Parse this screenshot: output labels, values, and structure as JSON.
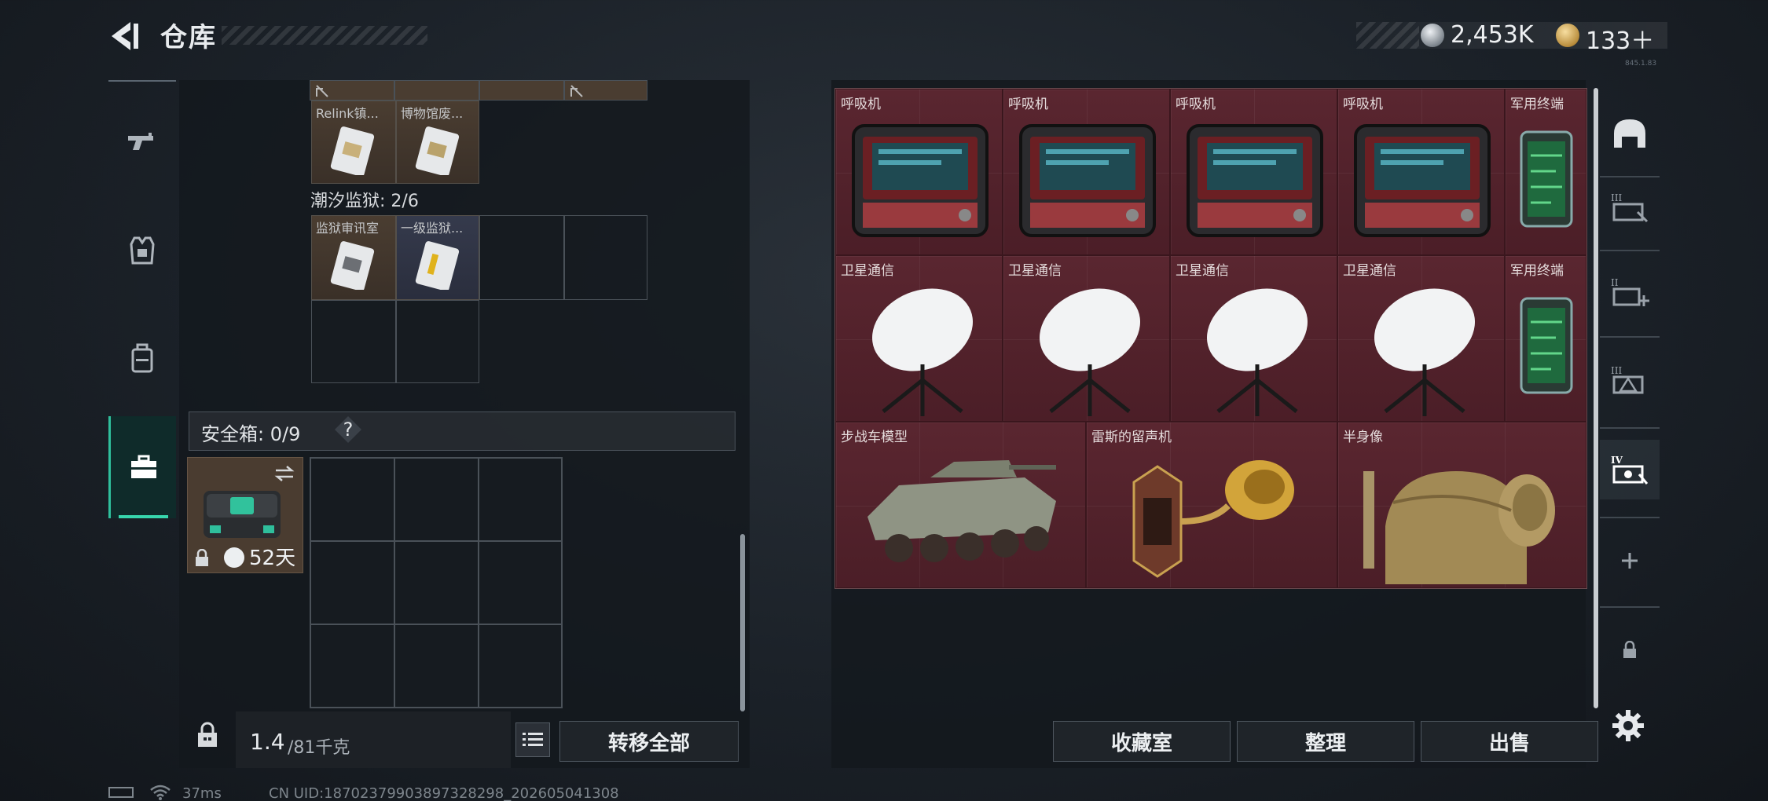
{
  "header": {
    "title": "仓库",
    "back_icon": "back-arrow-icon",
    "currency": {
      "silver_amount": "2,453K",
      "gold_amount": "133＋",
      "silver_icon": "silver-coin-icon",
      "gold_icon": "gold-coin-icon"
    },
    "version": "845.1.83"
  },
  "left_tabs": [
    {
      "icon": "pistol-icon",
      "active": false
    },
    {
      "icon": "armor-vest-icon",
      "active": false
    },
    {
      "icon": "backpack-icon",
      "active": false
    },
    {
      "icon": "toolbox-icon",
      "active": true
    }
  ],
  "stash": {
    "keycards_top": [
      {
        "label": "Relink镇...",
        "color": "brown"
      },
      {
        "label": "博物馆废...",
        "color": "brown"
      }
    ],
    "section_label": "潮汐监狱: 2/6",
    "keycards_prison": [
      {
        "label": "监狱审讯室",
        "color": "brown"
      },
      {
        "label": "一级监狱...",
        "color": "blue"
      }
    ],
    "safe_box": {
      "label": "安全箱: 0/9",
      "help": "?",
      "timer": "52天"
    }
  },
  "bottom_left": {
    "weight_current": "1.4",
    "weight_max": "/81千克",
    "list_icon": "list-icon",
    "transfer_label": "转移全部"
  },
  "collection_items": [
    {
      "label": "呼吸机",
      "type": "ventilator"
    },
    {
      "label": "呼吸机",
      "type": "ventilator"
    },
    {
      "label": "呼吸机",
      "type": "ventilator"
    },
    {
      "label": "呼吸机",
      "type": "ventilator"
    },
    {
      "label": "军用终端",
      "type": "terminal"
    },
    {
      "label": "卫星通信",
      "type": "satellite"
    },
    {
      "label": "卫星通信",
      "type": "satellite"
    },
    {
      "label": "卫星通信",
      "type": "satellite"
    },
    {
      "label": "卫星通信",
      "type": "satellite"
    },
    {
      "label": "军用终端",
      "type": "terminal"
    },
    {
      "label": "步战车模型",
      "type": "ifv"
    },
    {
      "label": "雷斯的留声机",
      "type": "gramophone"
    },
    {
      "label": "半身像",
      "type": "bust"
    }
  ],
  "right_tabs": [
    {
      "icon": "helmet-icon",
      "label": ""
    },
    {
      "icon": "tier-3-storage-icon",
      "label": "III"
    },
    {
      "icon": "tier-2-add-icon",
      "label": "II"
    },
    {
      "icon": "tier-3-alert-icon",
      "label": "III"
    },
    {
      "icon": "tier-4-storage-icon",
      "label": "IV"
    },
    {
      "icon": "add-icon",
      "label": "+"
    },
    {
      "icon": "lock-icon",
      "label": ""
    }
  ],
  "bottom_right": {
    "collection_label": "收藏室",
    "sort_label": "整理",
    "sell_label": "出售",
    "settings_icon": "gear-icon"
  },
  "status_bar": {
    "ping": "37ms",
    "uid": "CN UID:18702379903897328298_202605041308"
  },
  "colors": {
    "accent_teal": "#37d6ad",
    "collection_bg": "#4b1e27",
    "card_brown": "#4a3d31",
    "card_blue": "#353a4c"
  }
}
